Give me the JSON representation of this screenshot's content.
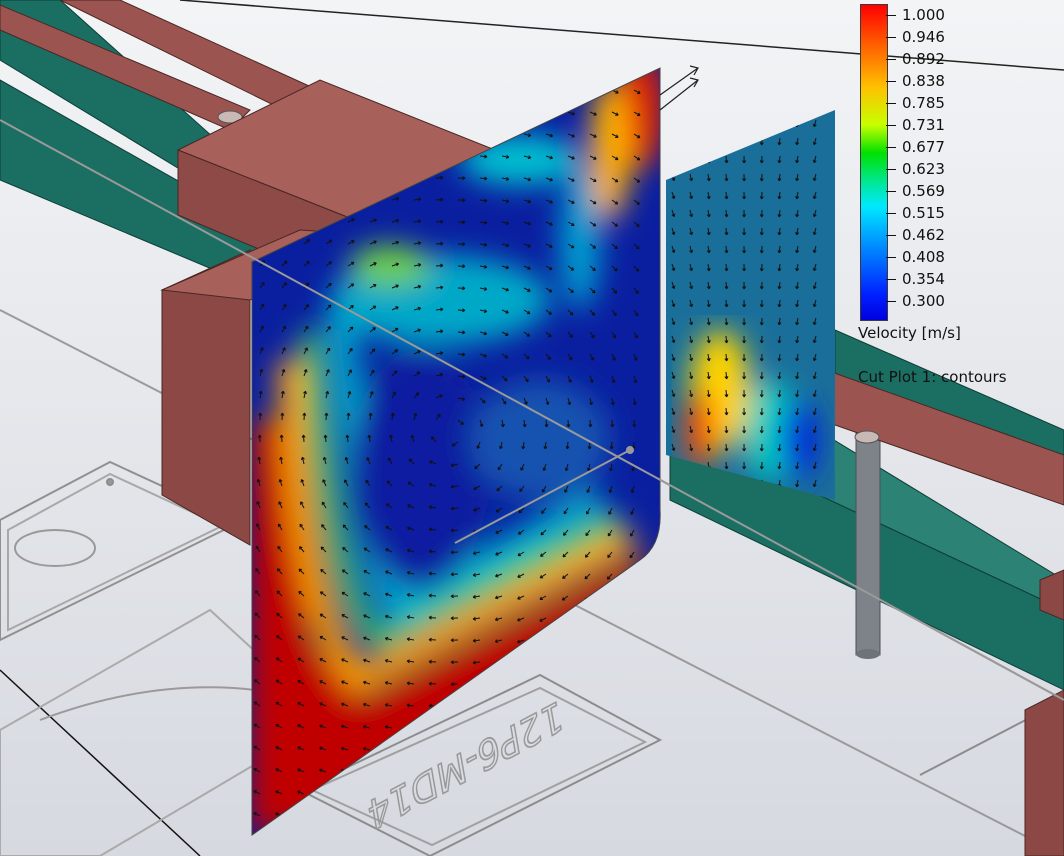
{
  "legend": {
    "title": "Velocity [m/s]",
    "ticks": [
      "1.000",
      "0.946",
      "0.892",
      "0.838",
      "0.785",
      "0.731",
      "0.677",
      "0.623",
      "0.569",
      "0.515",
      "0.462",
      "0.408",
      "0.354",
      "0.300"
    ],
    "colors": {
      "max": "#ff0000",
      "high": "#ffc000",
      "mid": "#00e000",
      "low_mid": "#00e8ff",
      "min": "#0000e0"
    }
  },
  "plot_label": "Cut Plot 1: contours",
  "part_engraving": "12P6-MD14",
  "colors": {
    "background": "#d9dce2",
    "part_red": "#9c5450",
    "part_teal": "#1b6e62",
    "rod": "#7d8389"
  }
}
